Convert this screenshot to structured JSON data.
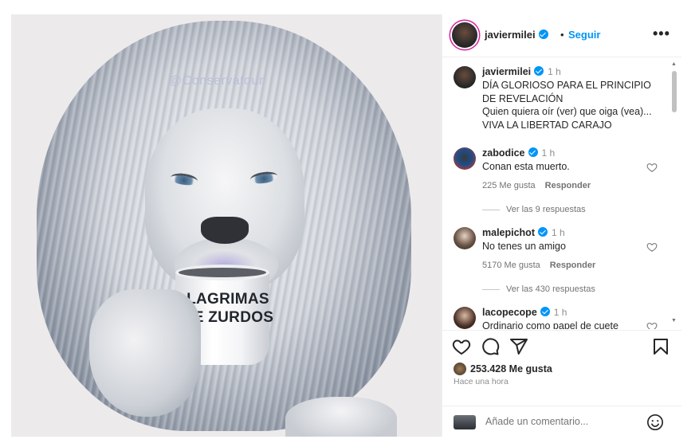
{
  "post": {
    "username": "javiermilei",
    "separator": "•",
    "follow_label": "Seguir",
    "more_label": "•••",
    "image": {
      "watermark": "@Conservatour",
      "mug_text": "LAGRIMAS\nDE ZURDOS"
    }
  },
  "caption": {
    "username": "javiermilei",
    "time": "1 h",
    "lines": [
      "DÍA GLORIOSO PARA EL PRINCIPIO DE REVELACIÓN",
      "Quien quiera oír (ver) que oiga (vea)...",
      "VIVA LA LIBERTAD CARAJO"
    ]
  },
  "comments": [
    {
      "username": "zabodice",
      "time": "1 h",
      "text": "Conan esta muerto.",
      "likes": "225 Me gusta",
      "reply_label": "Responder",
      "view_replies": "Ver las 9 respuestas"
    },
    {
      "username": "malepichot",
      "time": "1 h",
      "text": "No tenes un amigo",
      "likes": "5170 Me gusta",
      "reply_label": "Responder",
      "view_replies": "Ver las 430 respuestas"
    },
    {
      "username": "lacopecope",
      "time": "1 h",
      "text": "Ordinario como papel de cuete"
    }
  ],
  "actions": {
    "likes_count": "253.428 Me gusta",
    "time_ago": "Hace una hora",
    "comment_placeholder": "Añade un comentario..."
  },
  "colors": {
    "accent_blue": "#0095f6",
    "text_primary": "#262626",
    "text_secondary": "#8e8e8e",
    "story_ring": "#d6249f"
  },
  "icons": [
    "heart-icon",
    "comment-icon",
    "share-icon",
    "bookmark-icon",
    "emoji-icon",
    "verified-badge-icon",
    "more-options-icon"
  ]
}
